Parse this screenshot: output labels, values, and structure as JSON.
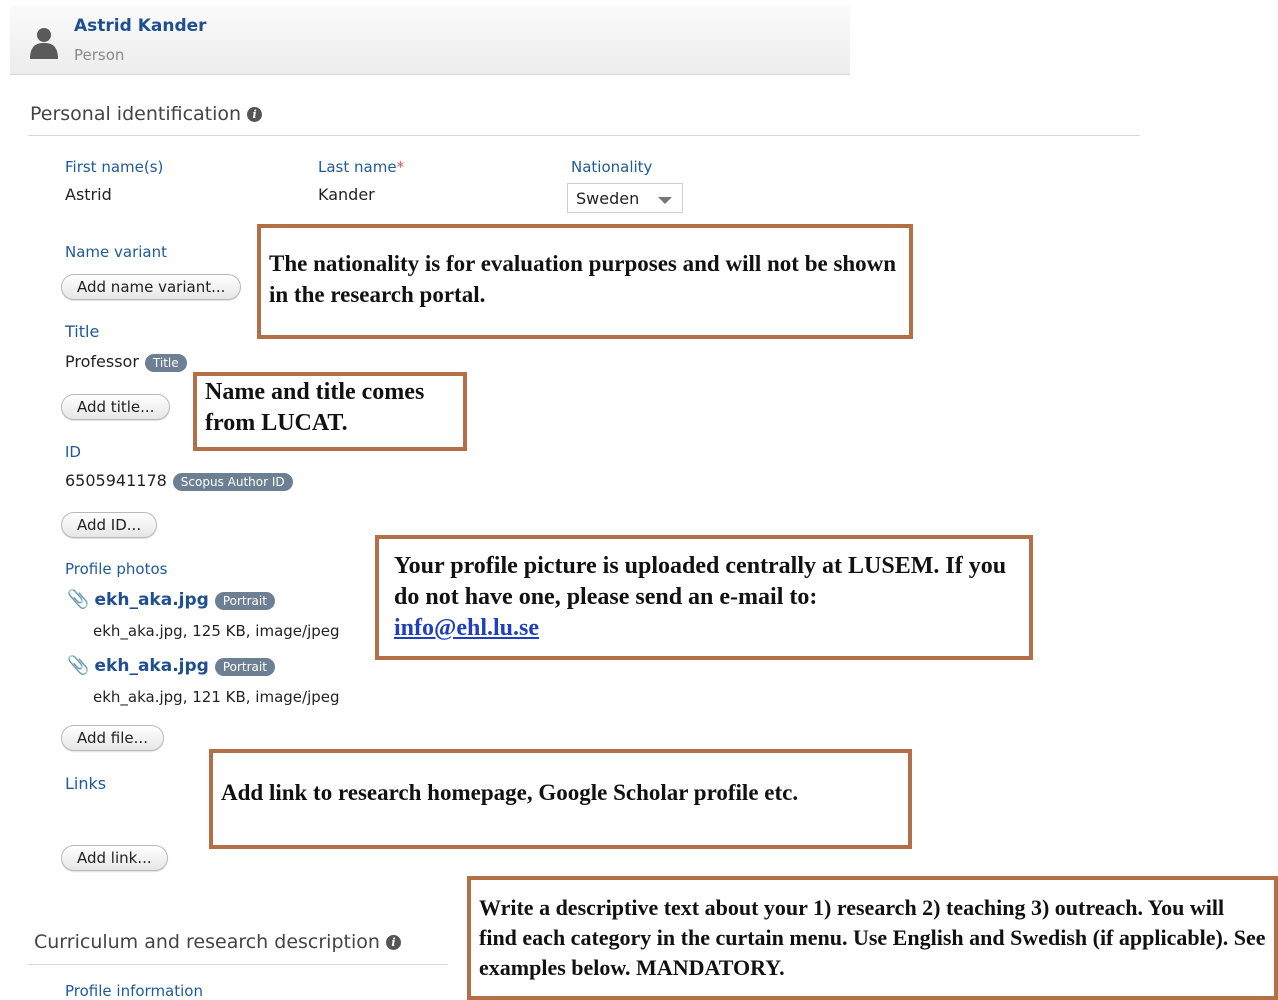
{
  "header": {
    "name": "Astrid Kander",
    "type": "Person"
  },
  "personal_identification": {
    "title": "Personal identification",
    "first_name_label": "First name(s)",
    "first_name_value": "Astrid",
    "last_name_label": "Last name",
    "required_mark": "*",
    "last_name_value": "Kander",
    "nationality_label": "Nationality",
    "nationality_value": "Sweden",
    "name_variant_label": "Name variant",
    "add_name_variant_button": "Add name variant...",
    "title_label": "Title",
    "title_value": "Professor",
    "title_badge": "Title",
    "add_title_button": "Add title...",
    "id_label": "ID",
    "id_value": "6505941178",
    "id_badge": "Scopus Author ID",
    "add_id_button": "Add ID...",
    "profile_photos_label": "Profile photos",
    "photos": [
      {
        "name": "ekh_aka.jpg",
        "badge": "Portrait",
        "meta": "ekh_aka.jpg, 125 KB, image/jpeg"
      },
      {
        "name": "ekh_aka.jpg",
        "badge": "Portrait",
        "meta": "ekh_aka.jpg, 121 KB, image/jpeg"
      }
    ],
    "add_file_button": "Add file...",
    "links_label": "Links",
    "add_link_button": "Add link..."
  },
  "curriculum": {
    "title": "Curriculum and research description",
    "profile_information_label": "Profile information"
  },
  "notes": {
    "nationality": "The nationality is for evaluation purposes and will not be shown in the research portal.",
    "name_title": "Name and title comes from LUCAT.",
    "picture_text": "Your profile picture is uploaded centrally at LUSEM. If you do not have one, please send an e-mail to:",
    "picture_email": "info@ehl.lu.se",
    "links": "Add link to research homepage, Google Scholar profile etc.",
    "description": "Write a descriptive text about your 1) research 2) teaching 3) outreach. You will find each category in the curtain menu. Use English and Swedish (if applicable). See examples below. MANDATORY."
  },
  "colors": {
    "link_blue": "#1f4f8f",
    "label_blue": "#1f5a99",
    "note_border": "#b36f45",
    "badge_gray": "#6d7f92"
  }
}
